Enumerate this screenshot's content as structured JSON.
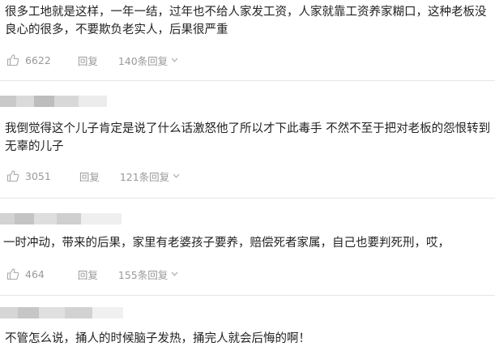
{
  "comments": [
    {
      "text": "很多工地就是这样，一年一结，过年也不给人家发工资，人家就靠工资养家糊口，这种老板没良心的很多，不要欺负老实人，后果很严重",
      "likes": "6622",
      "reply_label": "回复",
      "replies_label": "140条回复"
    },
    {
      "text": "我倒觉得这个儿子肯定是说了什么话激怒他了所以才下此毒手 不然不至于把对老板的怨恨转到无辜的儿子",
      "likes": "3051",
      "reply_label": "回复",
      "replies_label": "121条回复"
    },
    {
      "text": "一时冲动，带来的后果，家里有老婆孩子要养，赔偿死者家属，自己也要判死刑，哎，",
      "likes": "464",
      "reply_label": "回复",
      "replies_label": "155条回复"
    },
    {
      "text": "不管怎么说，捅人的时候脑子发热，捅完人就会后悔的啊！"
    }
  ],
  "colors": {
    "text": "#222222",
    "meta": "#999999",
    "divider": "#e6e6e6"
  },
  "icons": {
    "like": "thumbs-up-icon",
    "expand": "chevron-down-icon"
  }
}
